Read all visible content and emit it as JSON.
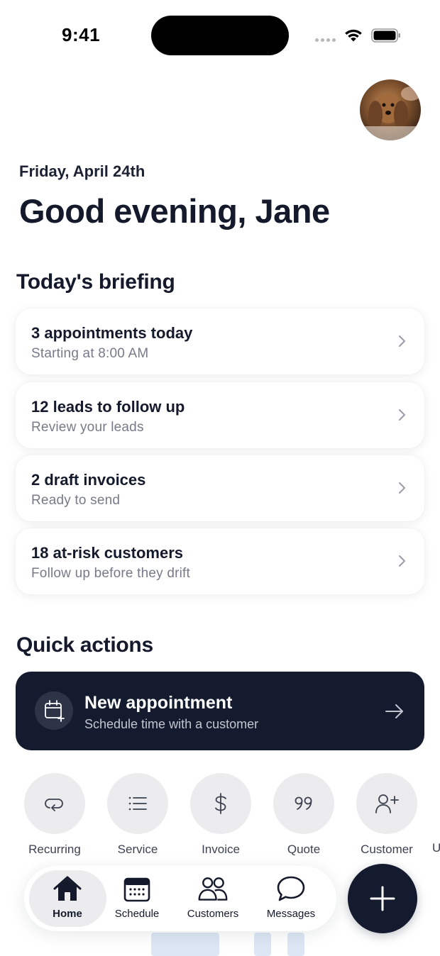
{
  "status_bar": {
    "time": "9:41"
  },
  "header": {
    "date": "Friday, April 24th",
    "greeting": "Good evening, Jane"
  },
  "briefing": {
    "title": "Today's briefing",
    "items": [
      {
        "title": "3 appointments today",
        "subtitle": "Starting at 8:00 AM"
      },
      {
        "title": "12 leads to follow up",
        "subtitle": "Review your leads"
      },
      {
        "title": "2 draft invoices",
        "subtitle": "Ready to send"
      },
      {
        "title": "18 at-risk customers",
        "subtitle": "Follow up before they drift"
      }
    ]
  },
  "quick_actions": {
    "title": "Quick actions",
    "primary": {
      "title": "New appointment",
      "subtitle": "Schedule time with a customer",
      "icon": "calendar-plus-icon"
    },
    "items": [
      {
        "label": "Recurring",
        "icon": "repeat-icon"
      },
      {
        "label": "Service",
        "icon": "list-icon"
      },
      {
        "label": "Invoice",
        "icon": "dollar-icon"
      },
      {
        "label": "Quote",
        "icon": "quote-icon"
      },
      {
        "label": "Customer",
        "icon": "add-person-icon"
      }
    ],
    "cut_off_label": "U"
  },
  "tabbar": {
    "tabs": [
      {
        "label": "Home",
        "icon": "home-icon",
        "active": true
      },
      {
        "label": "Schedule",
        "icon": "calendar-icon",
        "active": false
      },
      {
        "label": "Customers",
        "icon": "people-icon",
        "active": false
      },
      {
        "label": "Messages",
        "icon": "chat-bubble-icon",
        "active": false
      }
    ],
    "fab_icon": "plus-icon"
  },
  "colors": {
    "primary_dark": "#141b2e",
    "text_secondary": "#767b87",
    "chip_background": "#ececee"
  }
}
